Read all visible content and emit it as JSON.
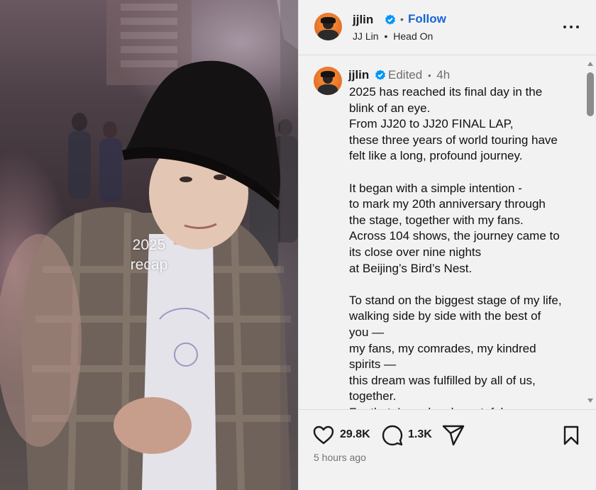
{
  "media": {
    "overlay_text_line1": "2025",
    "overlay_text_line2": "recap"
  },
  "header": {
    "username": "jjlin",
    "verified": true,
    "separator": "•",
    "follow_label": "Follow",
    "artist": "JJ Lin",
    "sub_separator": "•",
    "song": "Head On",
    "more_icon": "more-horizontal-icon"
  },
  "caption": {
    "username": "jjlin",
    "verified": true,
    "edited_label": "Edited",
    "time_separator": "•",
    "time_ago": "4h",
    "lines": [
      "2025 has reached its final day in the",
      "blink of an eye.",
      "From JJ20 to JJ20 FINAL LAP,",
      "these three years of world touring have",
      "felt like a long, profound journey.",
      "",
      "It began with a simple intention -",
      "to mark my 20th anniversary through",
      "the stage, together with my fans.",
      "Across 104 shows, the journey came to",
      "its close over nine nights",
      "at Beijing’s Bird’s Nest.",
      "",
      "To stand on the biggest stage of my life,",
      "walking side by side with the best of",
      "you —",
      "my fans, my comrades, my kindred",
      "spirits —",
      "this dream was fulfilled by all of us,",
      "together.",
      "For that, I am deeply grateful."
    ]
  },
  "actions": {
    "like_icon": "heart-icon",
    "likes": "29.8K",
    "comment_icon": "comment-icon",
    "comments": "1.3K",
    "share_icon": "paper-plane-icon",
    "save_icon": "bookmark-icon",
    "timestamp": "5 hours ago"
  },
  "colors": {
    "accent": "#1565d8",
    "verified": "#0095f6",
    "panel_bg": "#f2f2f2"
  }
}
